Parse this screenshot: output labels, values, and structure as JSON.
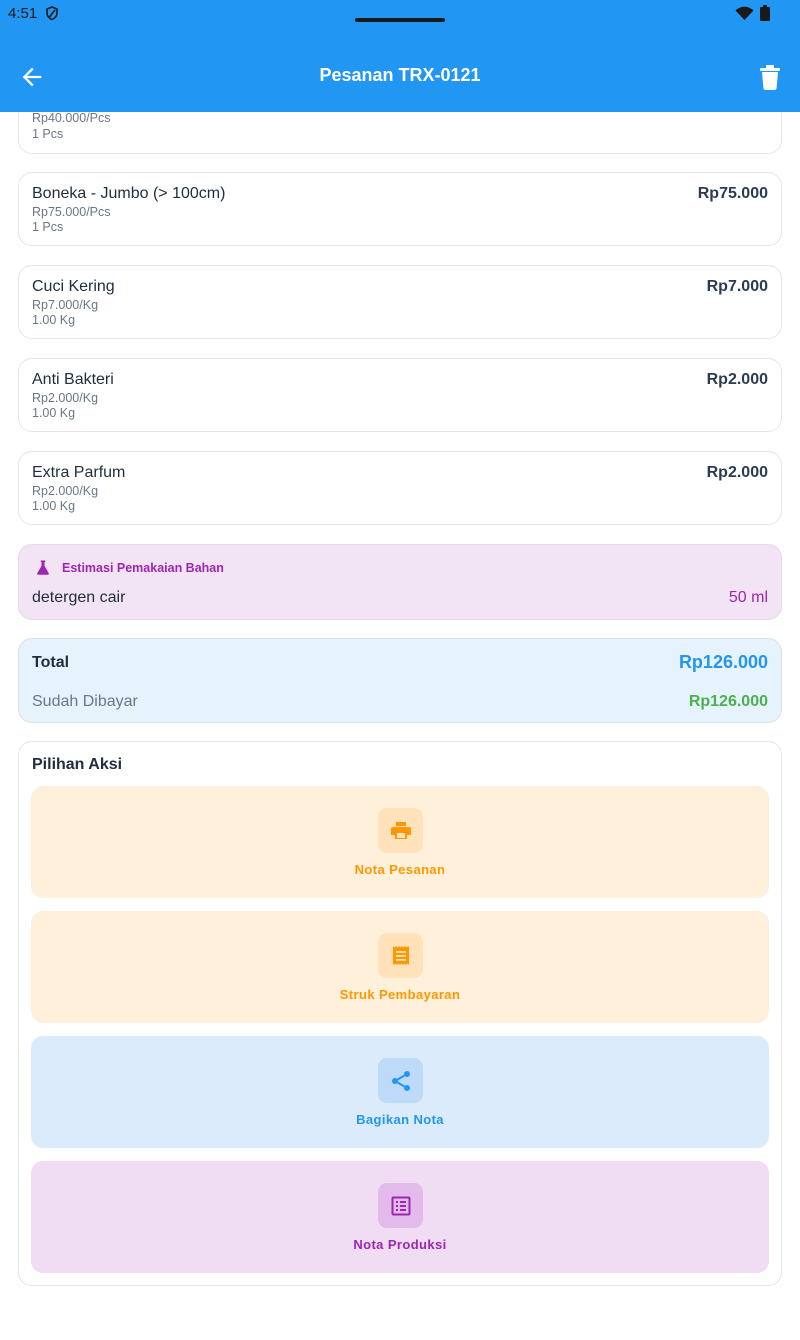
{
  "status_bar": {
    "time": "4:51"
  },
  "appbar": {
    "title": "Pesanan TRX-0121"
  },
  "items": [
    {
      "name": "",
      "price": "",
      "unit_price": "Rp40.000/Pcs",
      "qty": "1 Pcs"
    },
    {
      "name": "Boneka - Jumbo (> 100cm)",
      "price": "Rp75.000",
      "unit_price": "Rp75.000/Pcs",
      "qty": "1 Pcs"
    },
    {
      "name": "Cuci Kering",
      "price": "Rp7.000",
      "unit_price": "Rp7.000/Kg",
      "qty": "1.00 Kg"
    },
    {
      "name": "Anti Bakteri",
      "price": "Rp2.000",
      "unit_price": "Rp2.000/Kg",
      "qty": "1.00 Kg"
    },
    {
      "name": "Extra Parfum",
      "price": "Rp2.000",
      "unit_price": "Rp2.000/Kg",
      "qty": "1.00 Kg"
    }
  ],
  "estimasi": {
    "label": "Estimasi Pemakaian Bahan",
    "material": "detergen cair",
    "amount": "50 ml"
  },
  "summary": {
    "total_label": "Total",
    "total_value": "Rp126.000",
    "paid_label": "Sudah Dibayar",
    "paid_value": "Rp126.000"
  },
  "actions": {
    "heading": "Pilihan Aksi",
    "items": [
      {
        "label": "Nota Pesanan",
        "icon": "printer-icon"
      },
      {
        "label": "Struk Pembayaran",
        "icon": "receipt-icon"
      },
      {
        "label": "Bagikan Nota",
        "icon": "share-icon"
      },
      {
        "label": "Nota Produksi",
        "icon": "list-icon"
      }
    ]
  },
  "colors": {
    "primary": "#2196F3",
    "orange": "#FF9800",
    "purple": "#9C27B0",
    "green": "#4CAF50"
  }
}
